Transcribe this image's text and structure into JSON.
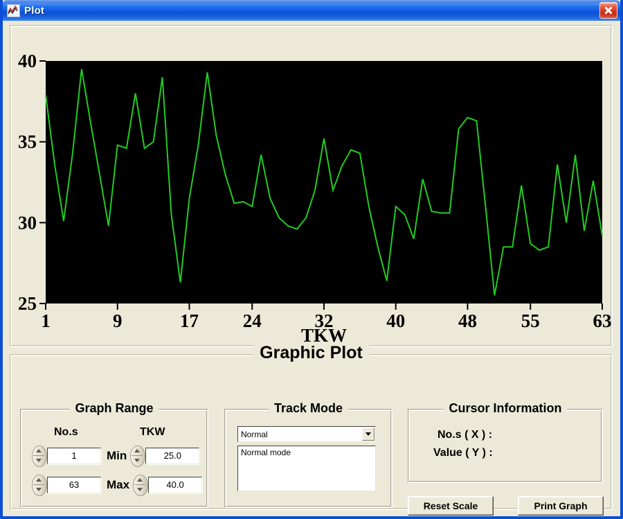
{
  "window": {
    "title": "Plot",
    "icon": "chart-icon",
    "close_label": "×",
    "titlebar_color": "#0a55dd",
    "client_bg": "#ece9d8"
  },
  "plot_panel": {
    "legend": "Graphic Plot"
  },
  "graph_range": {
    "legend": "Graph Range",
    "col_head_nos": "No.s",
    "col_head_tkw": "TKW",
    "min_label": "Min",
    "max_label": "Max",
    "nos_min_value": "1",
    "nos_max_value": "63",
    "tkw_min_value": "25.0",
    "tkw_max_value": "40.0"
  },
  "track_mode": {
    "legend": "Track Mode",
    "selected": "Normal",
    "description": "Normal mode",
    "options": [
      "Normal"
    ]
  },
  "cursor_info": {
    "legend": "Cursor Information",
    "x_label": "No.s ( X ) :",
    "x_value": "",
    "y_label": "Value ( Y ) :",
    "y_value": ""
  },
  "buttons": {
    "reset_scale": "Reset Scale",
    "print_graph": "Print Graph"
  },
  "chart_data": {
    "type": "line",
    "title": "",
    "xlabel": "TKW",
    "ylabel": "",
    "xlim": [
      1,
      63
    ],
    "ylim": [
      25,
      40
    ],
    "xticks": [
      1,
      9,
      17,
      24,
      32,
      40,
      48,
      55,
      63
    ],
    "yticks": [
      25,
      30,
      35,
      40
    ],
    "grid": false,
    "legend_position": "none",
    "plot_bg": "#000000",
    "line_color": "#22cc22",
    "series": [
      {
        "name": "TKW",
        "x": [
          1,
          2,
          3,
          4,
          5,
          6,
          7,
          8,
          9,
          10,
          11,
          12,
          13,
          14,
          15,
          16,
          17,
          18,
          19,
          20,
          21,
          22,
          23,
          24,
          25,
          26,
          27,
          28,
          29,
          30,
          31,
          32,
          33,
          34,
          35,
          36,
          37,
          38,
          39,
          40,
          41,
          42,
          43,
          44,
          45,
          46,
          47,
          48,
          49,
          50,
          51,
          52,
          53,
          54,
          55,
          56,
          57,
          58,
          59,
          60,
          61,
          62,
          63
        ],
        "values": [
          37.9,
          33.6,
          30.1,
          34.3,
          39.5,
          36.2,
          33.0,
          29.8,
          34.8,
          34.6,
          38.0,
          34.6,
          35.0,
          39.0,
          30.5,
          26.3,
          31.5,
          34.8,
          39.3,
          35.4,
          33.0,
          31.2,
          31.3,
          31.0,
          34.2,
          31.5,
          30.3,
          29.8,
          29.6,
          30.3,
          32.0,
          35.2,
          32.0,
          33.5,
          34.5,
          34.3,
          31.0,
          28.5,
          26.4,
          31.0,
          30.5,
          29.0,
          32.7,
          30.7,
          30.6,
          30.6,
          35.8,
          36.5,
          36.3,
          31.0,
          25.5,
          28.5,
          28.5,
          32.3,
          28.7,
          28.3,
          28.5,
          33.6,
          30.0,
          34.2,
          29.5,
          32.6,
          29.2
        ]
      }
    ]
  }
}
